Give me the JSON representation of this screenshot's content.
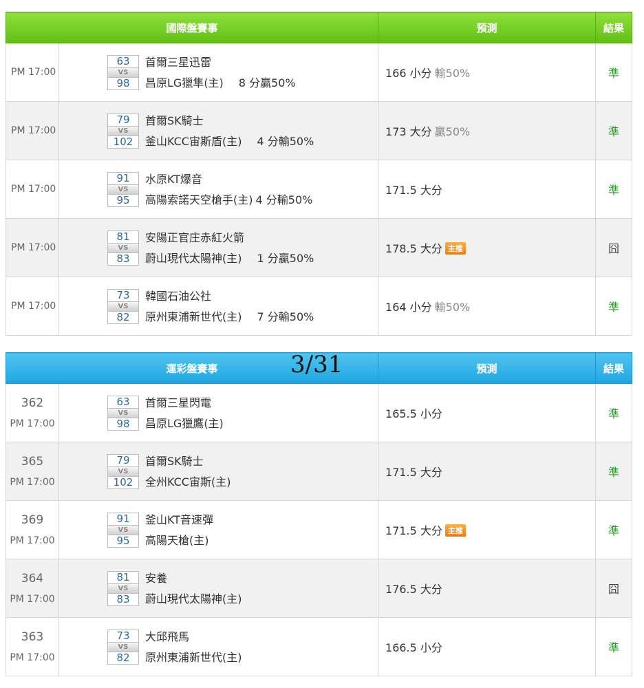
{
  "international": {
    "headers": {
      "game": "國際盤賽事",
      "prediction": "預測",
      "result": "結果"
    },
    "rows": [
      {
        "time": "PM 17:00",
        "score_away": "63",
        "score_home": "98",
        "vs": "VS",
        "team_away": "首爾三星迅雷",
        "team_home": "昌原LG獵隼(主)",
        "handicap": "8 分贏50%",
        "pred_value": "166 小分",
        "pred_outcome": "輸50%",
        "badge": "",
        "result": "準"
      },
      {
        "time": "PM 17:00",
        "score_away": "79",
        "score_home": "102",
        "vs": "VS",
        "team_away": "首爾SK騎士",
        "team_home": "釜山KCC宙斯盾(主)",
        "handicap": "4 分輸50%",
        "pred_value": "173 大分",
        "pred_outcome": "贏50%",
        "badge": "",
        "result": "準"
      },
      {
        "time": "PM 17:00",
        "score_away": "91",
        "score_home": "95",
        "vs": "VS",
        "team_away": "水原KT爆音",
        "team_home": "高陽索諾天空槍手(主)",
        "handicap": "4 分輸50%",
        "pred_value": "171.5 大分",
        "pred_outcome": "",
        "badge": "",
        "result": "準"
      },
      {
        "time": "PM 17:00",
        "score_away": "81",
        "score_home": "83",
        "vs": "VS",
        "team_away": "安陽正官庄赤紅火箭",
        "team_home": "蔚山現代太陽神(主)",
        "handicap": "1 分贏50%",
        "pred_value": "178.5 大分",
        "pred_outcome": "",
        "badge": "主推",
        "result": "囧"
      },
      {
        "time": "PM 17:00",
        "score_away": "73",
        "score_home": "82",
        "vs": "VS",
        "team_away": "韓國石油公社",
        "team_home": "原州東浦新世代(主)",
        "handicap": "7 分輸50%",
        "pred_value": "164 小分",
        "pred_outcome": "輸50%",
        "badge": "",
        "result": "準"
      }
    ]
  },
  "date_label": "3/31",
  "lottery": {
    "headers": {
      "game": "運彩盤賽事",
      "prediction": "預測",
      "result": "結果"
    },
    "rows": [
      {
        "id": "362",
        "time": "PM 17:00",
        "score_away": "63",
        "score_home": "98",
        "vs": "VS",
        "team_away": "首爾三星閃電",
        "team_home": "昌原LG獵鷹(主)",
        "pred_value": "165.5 小分",
        "badge": "",
        "result": "準"
      },
      {
        "id": "365",
        "time": "PM 17:00",
        "score_away": "79",
        "score_home": "102",
        "vs": "VS",
        "team_away": "首爾SK騎士",
        "team_home": "全州KCC宙斯(主)",
        "pred_value": "171.5 大分",
        "badge": "",
        "result": "準"
      },
      {
        "id": "369",
        "time": "PM 17:00",
        "score_away": "91",
        "score_home": "95",
        "vs": "VS",
        "team_away": "釜山KT音速彈",
        "team_home": "高陽天槍(主)",
        "pred_value": "171.5 大分",
        "badge": "主推",
        "result": "準"
      },
      {
        "id": "364",
        "time": "PM 17:00",
        "score_away": "81",
        "score_home": "83",
        "vs": "VS",
        "team_away": "安養",
        "team_home": "蔚山現代太陽神(主)",
        "pred_value": "176.5 大分",
        "badge": "",
        "result": "囧"
      },
      {
        "id": "363",
        "time": "PM 17:00",
        "score_away": "73",
        "score_home": "82",
        "vs": "VS",
        "team_away": "大邱飛馬",
        "team_home": "原州東浦新世代(主)",
        "pred_value": "166.5 小分",
        "badge": "",
        "result": "準"
      }
    ]
  },
  "colors": {
    "result_correct": "#2a9a2a",
    "result_wrong": "#444444",
    "header_green": "#6ccb1f",
    "header_blue": "#29aee6"
  }
}
